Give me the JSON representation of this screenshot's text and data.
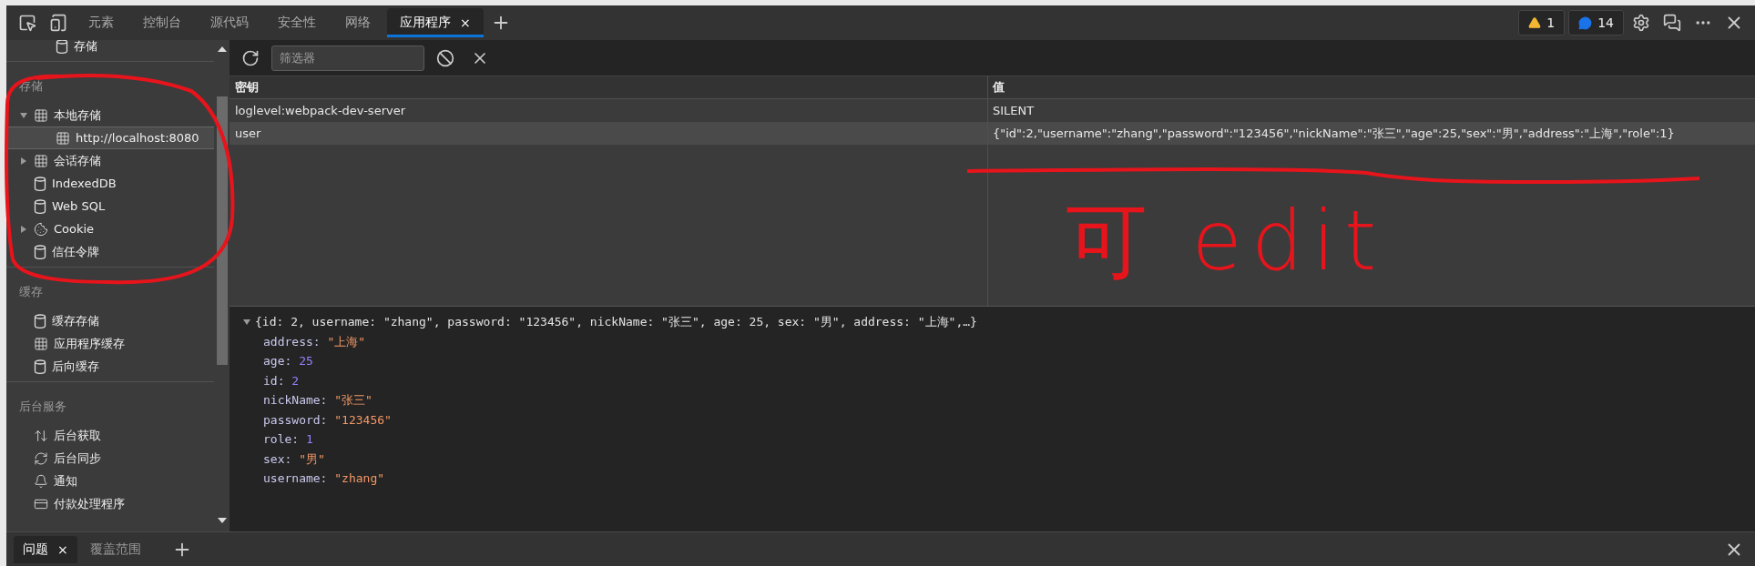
{
  "tabs": [
    {
      "label": "元素",
      "selected": false
    },
    {
      "label": "控制台",
      "selected": false
    },
    {
      "label": "源代码",
      "selected": false
    },
    {
      "label": "安全性",
      "selected": false
    },
    {
      "label": "网络",
      "selected": false
    },
    {
      "label": "应用程序",
      "selected": true
    }
  ],
  "tab_close": "×",
  "badges": {
    "warnings": "1",
    "messages": "14"
  },
  "sidebar": {
    "top_item": {
      "label": "存储",
      "kind": "db",
      "selected": false
    },
    "sections": [
      {
        "title": "存储",
        "items": [
          {
            "label": "本地存储",
            "kind": "grid",
            "expanded": true,
            "selected": false,
            "children": [
              {
                "label": "http://localhost:8080",
                "kind": "grid",
                "selected": true
              }
            ]
          },
          {
            "label": "会话存储",
            "kind": "grid",
            "expanded": false,
            "selected": false
          },
          {
            "label": "IndexedDB",
            "kind": "db",
            "selected": false
          },
          {
            "label": "Web SQL",
            "kind": "db",
            "selected": false
          },
          {
            "label": "Cookie",
            "kind": "cookie",
            "expanded": false,
            "selected": false
          },
          {
            "label": "信任令牌",
            "kind": "db",
            "selected": false
          }
        ]
      },
      {
        "title": "缓存",
        "items": [
          {
            "label": "缓存存储",
            "kind": "db",
            "selected": false
          },
          {
            "label": "应用程序缓存",
            "kind": "grid",
            "selected": false
          },
          {
            "label": "后向缓存",
            "kind": "db",
            "selected": false
          }
        ]
      },
      {
        "title": "后台服务",
        "items": [
          {
            "label": "后台获取",
            "kind": "arrows",
            "selected": false
          },
          {
            "label": "后台同步",
            "kind": "sync",
            "selected": false
          },
          {
            "label": "通知",
            "kind": "bell",
            "selected": false
          },
          {
            "label": "付款处理程序",
            "kind": "card",
            "selected": false
          }
        ]
      }
    ]
  },
  "filter": {
    "placeholder": "筛选器"
  },
  "table": {
    "columns": [
      "密钥",
      "值"
    ],
    "rows": [
      {
        "key": "loglevel:webpack-dev-server",
        "value": "SILENT",
        "selected": false
      },
      {
        "key": "user",
        "value": "{\"id\":2,\"username\":\"zhang\",\"password\":\"123456\",\"nickName\":\"张三\",\"age\":25,\"sex\":\"男\",\"address\":\"上海\",\"role\":1}",
        "selected": true
      }
    ]
  },
  "preview": {
    "summary": "{id: 2, username: \"zhang\", password: \"123456\", nickName: \"张三\", age: 25, sex: \"男\", address: \"上海\",…}",
    "expanded": true,
    "properties": [
      {
        "key": "address:",
        "value": "\"上海\"",
        "kind": "string"
      },
      {
        "key": "age:",
        "value": "25",
        "kind": "number"
      },
      {
        "key": "id:",
        "value": "2",
        "kind": "number"
      },
      {
        "key": "nickName:",
        "value": "\"张三\"",
        "kind": "string"
      },
      {
        "key": "password:",
        "value": "\"123456\"",
        "kind": "string"
      },
      {
        "key": "role:",
        "value": "1",
        "kind": "number"
      },
      {
        "key": "sex:",
        "value": "\"男\"",
        "kind": "string"
      },
      {
        "key": "username:",
        "value": "\"zhang\"",
        "kind": "string"
      }
    ]
  },
  "drawer": {
    "tabs": [
      {
        "label": "问题",
        "selected": true
      },
      {
        "label": "覆盖范围",
        "selected": false
      }
    ]
  },
  "annotation": {
    "text": "可 edit"
  }
}
